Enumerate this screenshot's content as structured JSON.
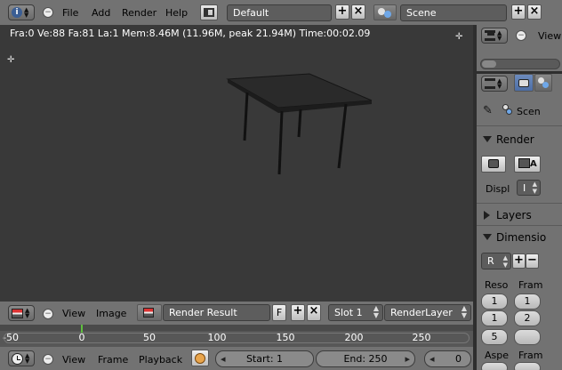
{
  "top_header": {
    "menus": [
      "File",
      "Add",
      "Render",
      "Help"
    ],
    "screen_layout": "Default",
    "scene": "Scene"
  },
  "viewport": {
    "info_text": "Fra:0  Ve:88 Fa:81 La:1 Mem:8.46M (11.96M, peak 21.94M) Time:00:02.09"
  },
  "image_editor_header": {
    "menus": [
      "View",
      "Image"
    ],
    "image_name": "Render Result",
    "fake_user": "F",
    "slot": "Slot 1",
    "render_layer": "RenderLayer"
  },
  "timeline": {
    "ticks": [
      "-50",
      "0",
      "50",
      "100",
      "150",
      "200",
      "250"
    ],
    "current_frame_marker": 0
  },
  "timeline_header": {
    "menus": [
      "View",
      "Frame",
      "Playback"
    ],
    "start": "Start: 1",
    "end": "End: 250",
    "current": "0"
  },
  "outliner_header": {
    "view": "View"
  },
  "properties": {
    "scene_label": "Scen",
    "render_panel": "Render",
    "display_label": "Displ",
    "display_value": "I",
    "layers_panel": "Layers",
    "dimensions_panel": "Dimensio",
    "preset_value": "R",
    "resolution_label": "Reso",
    "frame_label": "Fram",
    "res_x": "1",
    "res_y": "1",
    "res_pct": "5",
    "frame_start": "1",
    "frame_end": "2",
    "aspect_label": "Aspe",
    "frame_rate_label": "Fram"
  },
  "colors": {
    "header": "#727272",
    "viewport_bg": "#393939",
    "timeline_bg": "#575757",
    "current_frame": "#5fbf3f"
  }
}
